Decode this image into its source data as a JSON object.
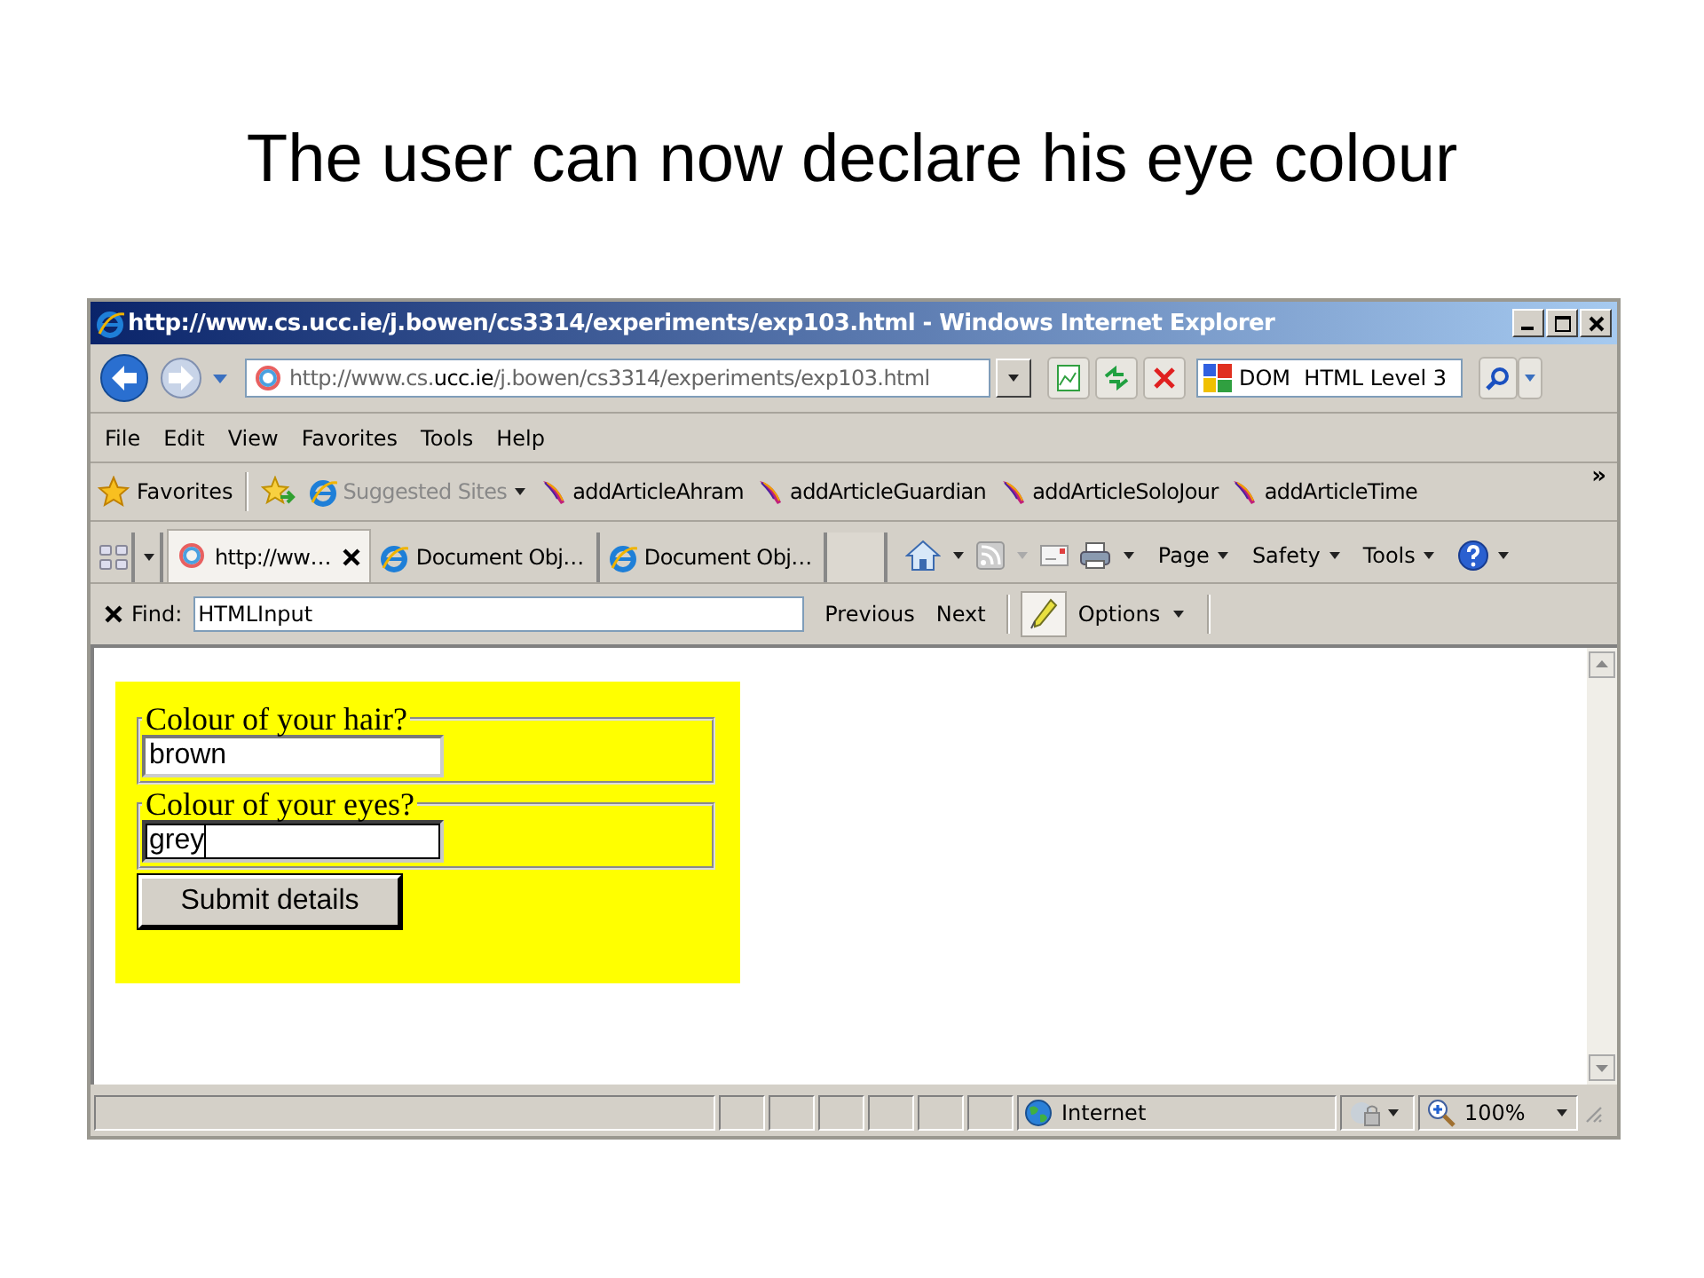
{
  "slide_title": "The user can now declare his eye colour",
  "window": {
    "title": "http://www.cs.ucc.ie/j.bowen/cs3314/experiments/exp103.html - Windows Internet Explorer",
    "address": "http://www.cs.**ucc.ie**/j.bowen/cs3314/experiments/exp103.html",
    "search_value": "DOM  HTML Level 3"
  },
  "menu": [
    "File",
    "Edit",
    "View",
    "Favorites",
    "Tools",
    "Help"
  ],
  "favorites_bar": {
    "label": "Favorites",
    "items": [
      {
        "kind": "dropdown",
        "label": "Suggested Sites"
      },
      {
        "kind": "link",
        "label": "addArticleAhram"
      },
      {
        "kind": "link",
        "label": "addArticleGuardian"
      },
      {
        "kind": "link",
        "label": "addArticleSoloJour"
      },
      {
        "kind": "link",
        "label": "addArticleTime"
      }
    ],
    "more": "»"
  },
  "tabs": [
    {
      "label": "http://ww…",
      "selected": true
    },
    {
      "label": "Document Obj…",
      "selected": false
    },
    {
      "label": "Document Obj…",
      "selected": false
    }
  ],
  "commands": [
    "Page",
    "Safety",
    "Tools"
  ],
  "find_bar": {
    "label": "Find:",
    "value": "HTMLInput",
    "buttons": [
      "Previous",
      "Next"
    ],
    "options": "Options",
    "highlight": true
  },
  "form": {
    "fieldsets": [
      {
        "legend": "Colour of your hair?",
        "value": "brown",
        "focused": false
      },
      {
        "legend": "Colour of your eyes?",
        "value": "grey",
        "focused": true
      }
    ],
    "submit": "Submit details"
  },
  "status_bar": {
    "zone": "Internet",
    "zoom": "100%"
  }
}
